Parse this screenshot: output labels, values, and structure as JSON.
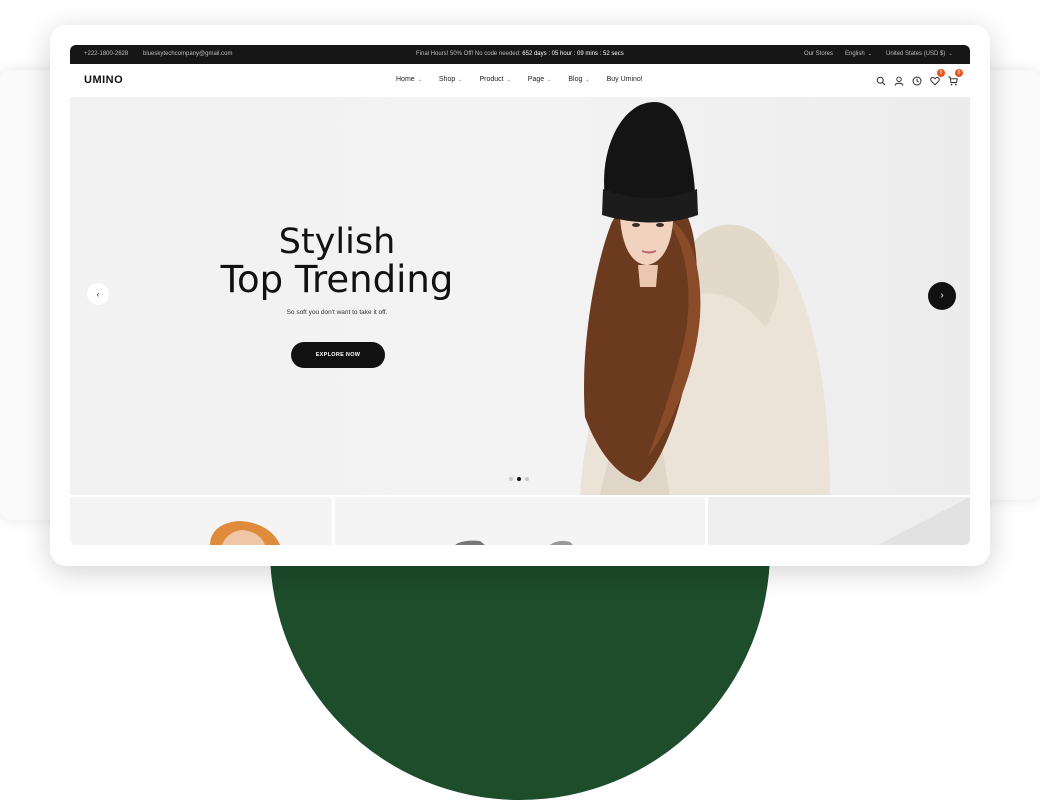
{
  "topbar": {
    "phone": "+222-1800-2628",
    "email": "blueskytechcompany@gmail.com",
    "promo": "Final Hours! 50% Off! No code needed:",
    "countdown": "652 days : 05 hour : 09 mins : 52 secs",
    "stores": "Our Stores",
    "language": "English",
    "currency": "United States (USD $)"
  },
  "header": {
    "logo": "UMINO",
    "nav": [
      {
        "label": "Home",
        "has_dropdown": true
      },
      {
        "label": "Shop",
        "has_dropdown": true
      },
      {
        "label": "Product",
        "has_dropdown": true
      },
      {
        "label": "Page",
        "has_dropdown": true
      },
      {
        "label": "Blog",
        "has_dropdown": true
      },
      {
        "label": "Buy Umino!",
        "has_dropdown": false
      }
    ],
    "icons": [
      "search-icon",
      "user-icon",
      "compare-icon",
      "wishlist-icon",
      "cart-icon"
    ],
    "wishlist_count": "0",
    "cart_count": "0"
  },
  "hero": {
    "title_line1": "Stylish",
    "title_line2": "Top Trending",
    "subtitle": "So soft you don't want to take it off.",
    "button": "EXPLORE NOW",
    "slides_total": 3,
    "active_slide": 2
  },
  "colors": {
    "accent": "#e8541c",
    "dark": "#111111",
    "background_shape": "#1d4d2b"
  }
}
